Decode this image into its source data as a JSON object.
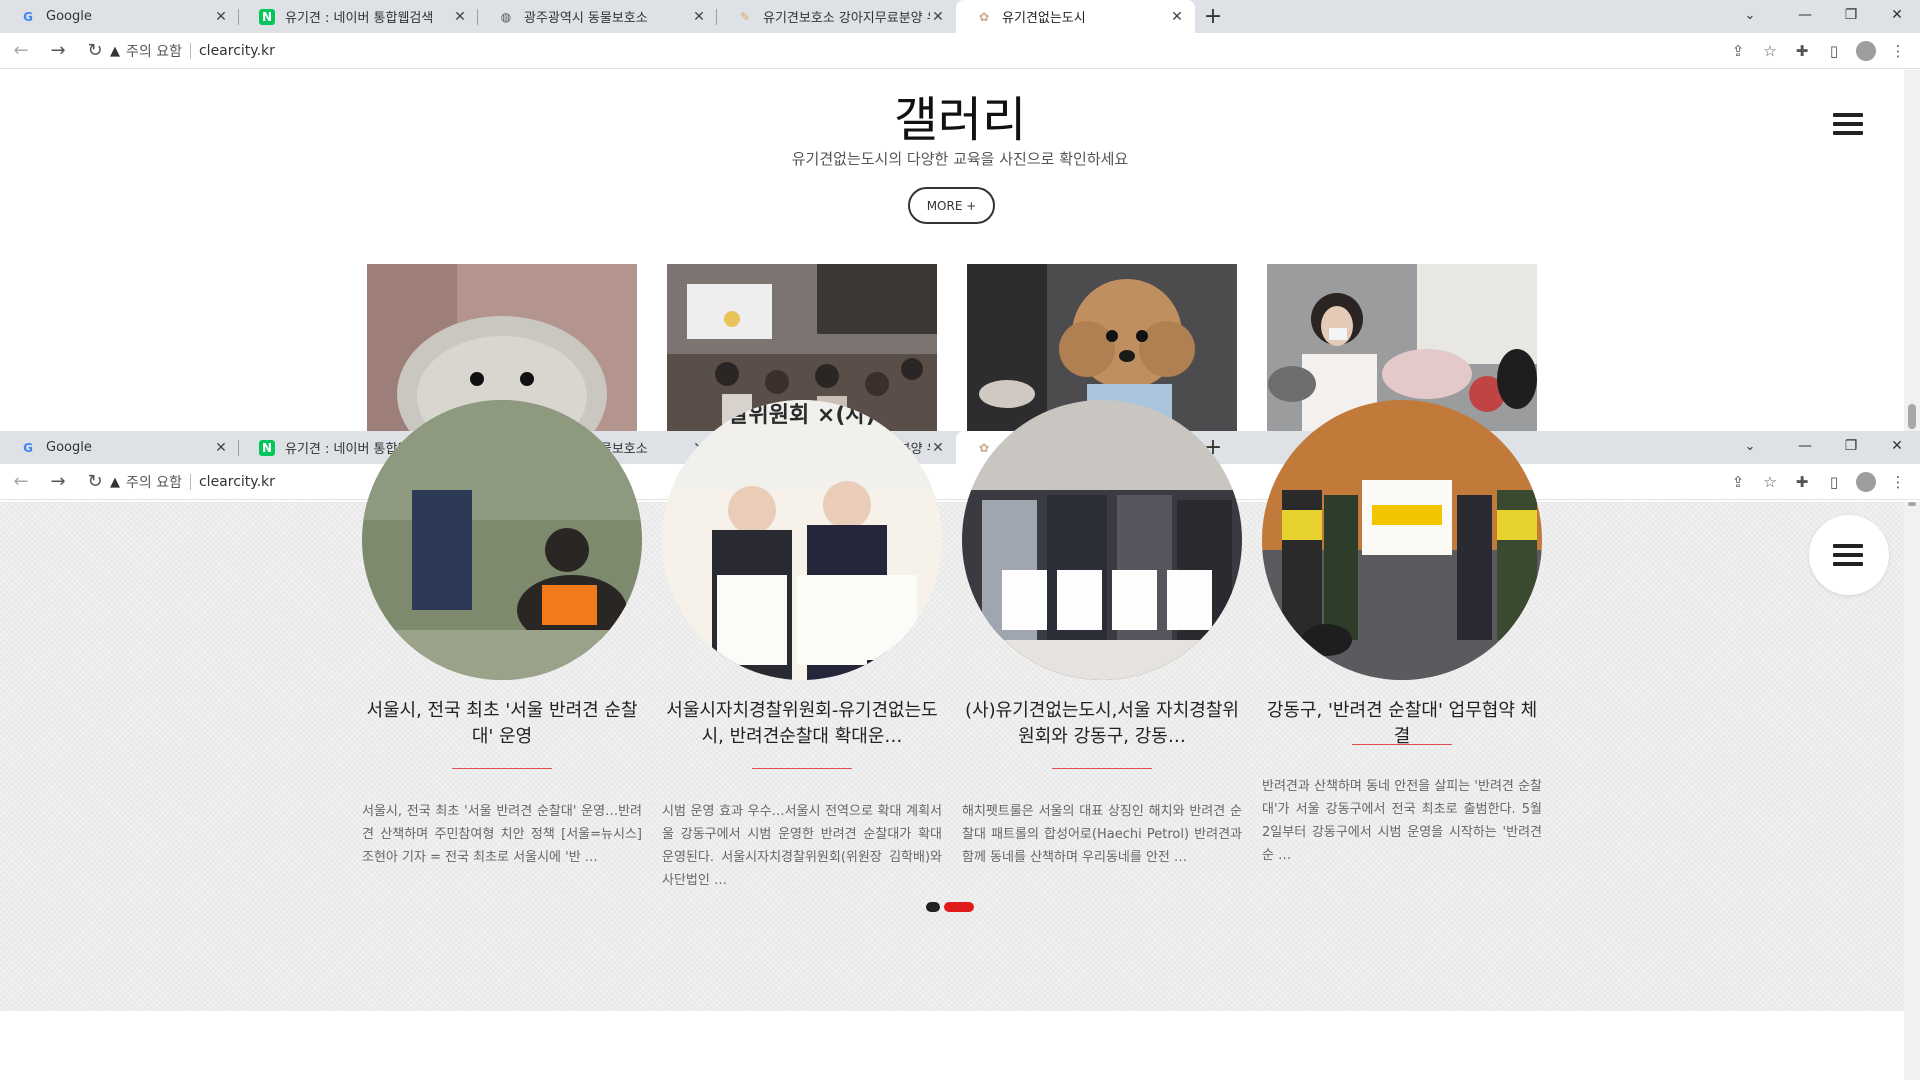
{
  "browser": {
    "tabs": [
      {
        "title": "Google",
        "favicon": "G",
        "fav_color": "#4285f4"
      },
      {
        "title": "유기견 : 네이버 통합웹검색",
        "favicon": "N",
        "fav_color": "#03c75a"
      },
      {
        "title": "광주광역시 동물보호소",
        "favicon": "◍",
        "fav_color": "#555555"
      },
      {
        "title": "유기견보호소 강아지무료분양 유",
        "favicon": "✎",
        "fav_color": "#e8a75b"
      },
      {
        "title": "유기견없는도시",
        "favicon": "✿",
        "fav_color": "#c9a98a"
      }
    ],
    "security_label": "주의 요함",
    "url": "clearcity.kr"
  },
  "gallery": {
    "title": "갤러리",
    "subtitle": "유기견없는도시의 다양한 교육을 사진으로 확인하세요",
    "more_label": "MORE +"
  },
  "news": {
    "items": [
      {
        "title": "서울시, 전국 최초 '서울 반려견 순찰대' 운영",
        "excerpt": "서울시, 전국 최초 '서울 반려견 순찰대' 운영…반려견 산책하며 주민참여형 치안 정책 [서울=뉴시스] 조현아 기자 = 전국 최초로 서울시에 '반 …"
      },
      {
        "title": "서울시자치경찰위원회-유기견없는도시, 반려견순찰대 확대운…",
        "excerpt": "시범 운영 효과 우수…서울시 전역으로 확대 계획서울 강동구에서 시범 운영한 반려견 순찰대가 확대 운영된다. 서울시자치경찰위원회(위원장 김학배)와 사단법인 …"
      },
      {
        "title": "(사)유기견없는도시,서울 자치경찰위원회와 강동구, 강동…",
        "excerpt": "해치펫트룰은 서울의 대표 상징인 해치와 반려견 순찰대 패트롤의 합성어로(Haechi Petrol) 반려견과 함께 동네를 산책하며 우리동네를 안전 …"
      },
      {
        "title": "강동구, '반려견 순찰대' 업무협약 체결",
        "excerpt": "반려견과 산책하며 동네 안전을 살피는 '반려견 순찰대'가 서울 강동구에서 전국 최초로 출범한다. 5월 2일부터 강동구에서 시범 운영을 시작하는 '반려견 순 …"
      }
    ]
  }
}
